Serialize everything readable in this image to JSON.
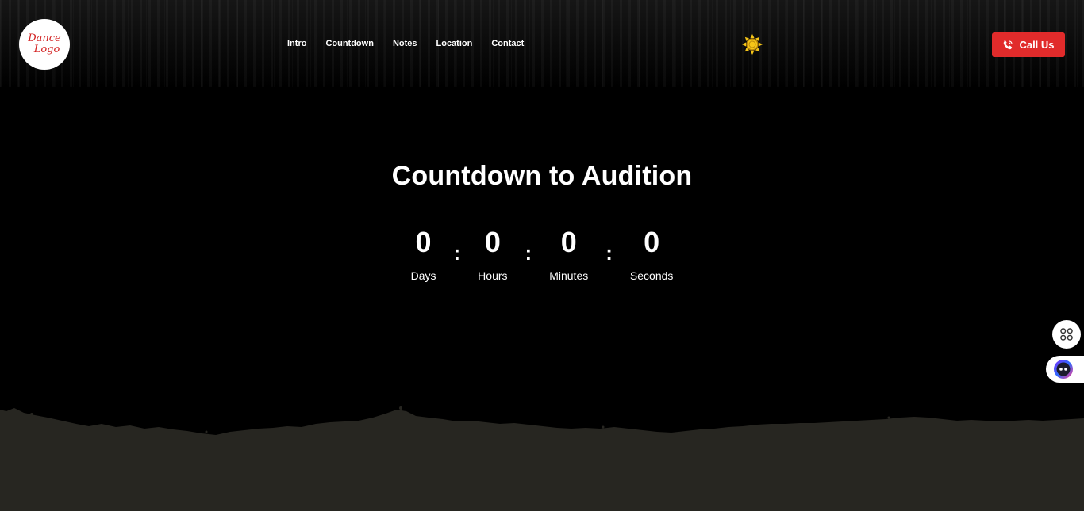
{
  "header": {
    "logo": {
      "line1": "Dance",
      "line2": "Logo"
    },
    "nav": [
      {
        "label": "Intro",
        "name": "nav-intro"
      },
      {
        "label": "Countdown",
        "name": "nav-countdown"
      },
      {
        "label": "Notes",
        "name": "nav-notes"
      },
      {
        "label": "Location",
        "name": "nav-location"
      },
      {
        "label": "Contact",
        "name": "nav-contact"
      }
    ],
    "theme_icon": "sun-icon",
    "call_button": {
      "label": "Call Us",
      "icon": "phone-icon"
    }
  },
  "countdown": {
    "title": "Countdown to Audition",
    "units": [
      {
        "value": "0",
        "label": "Days"
      },
      {
        "value": "0",
        "label": "Hours"
      },
      {
        "value": "0",
        "label": "Minutes"
      },
      {
        "value": "0",
        "label": "Seconds"
      }
    ],
    "separator": ":"
  },
  "side_widgets": {
    "grid_icon": "apps-grid-icon",
    "bot_icon": "chatbot-icon"
  },
  "colors": {
    "accent": "#e12b2b",
    "sun": "#f5c518",
    "background": "#000000",
    "ground": "#272621"
  }
}
